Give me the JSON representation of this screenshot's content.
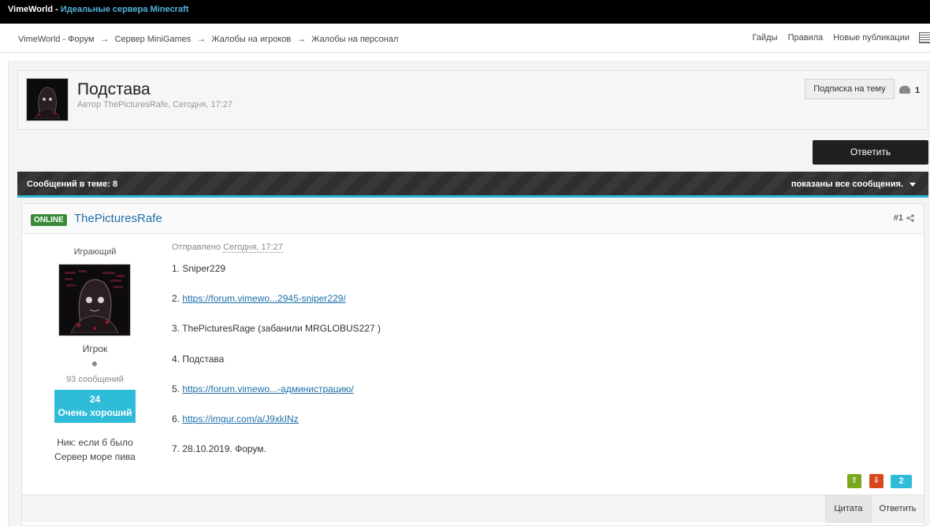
{
  "topbar": {
    "brand": "VimeWorld",
    "separator": " - ",
    "tagline": "Идеальные сервера Minecraft"
  },
  "breadcrumbs": [
    "VimeWorld - Форум",
    "Сервер MiniGames",
    "Жалобы на игроков",
    "Жалобы на персонал"
  ],
  "breadcrumb_separator": "→",
  "nav_links": [
    "Гайды",
    "Правила",
    "Новые публикации"
  ],
  "topic": {
    "title": "Подстава",
    "meta": "Автор ThePicturesRafe, Сегодня, 17:27",
    "subscribe_label": "Подписка на тему",
    "followers_count": "1"
  },
  "reply_main_label": "Ответить",
  "bar": {
    "left": "Сообщений в теме: 8",
    "right": "показаны все сообщения."
  },
  "post": {
    "status": "ONLINE",
    "author": "ThePicturesRafe",
    "number": "#1",
    "user_title": "Играющий",
    "group": "Игрок",
    "post_count": "93 сообщений",
    "reputation_value": "24",
    "reputation_label": "Очень хороший",
    "nick_line": "Ник: если б было",
    "server_line": "Сервер море пива",
    "posted_prefix": "Отправлено",
    "posted_date": "Сегодня, 17:27",
    "lines": {
      "l1": "1. Sniper229",
      "l2_prefix": "2. ",
      "l2_link": "https://forum.vimewo...2945-sniper229/",
      "l3": "3. ThePicturesRage (забанили MRGLOBUS227 )",
      "l4": "4. Подстава",
      "l5_prefix": "5. ",
      "l5_link": "https://forum.vimewo...-администрацию/",
      "l6_prefix": "6. ",
      "l6_link": "https://imgur.com/a/J9xkINz",
      "l7": "7. 28.10.2019. Форум."
    },
    "vote_count": "2",
    "quote_label": "Цитата",
    "reply_label": "Ответить"
  },
  "colors": {
    "accent": "#2ebcd8",
    "link": "#1d6fa8",
    "online": "#3a8a3a",
    "vote_up": "#7aa81d",
    "vote_down": "#d6481c"
  }
}
